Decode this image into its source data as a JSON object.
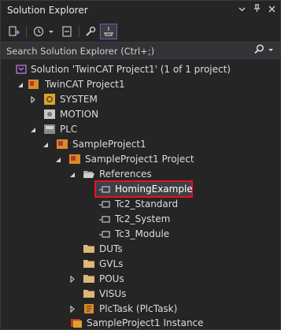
{
  "panel": {
    "title": "Solution Explorer",
    "title_icons": [
      "chevron-down-icon",
      "pin-icon",
      "close-icon"
    ]
  },
  "toolbar": {
    "buttons": [
      "switch-views-icon",
      "history-icon",
      "history-dropdown-icon",
      "collapse-all-icon",
      "properties-wrench-icon",
      "preview-selected-icon"
    ]
  },
  "search": {
    "placeholder": "Search Solution Explorer (Ctrl+;)"
  },
  "tree": {
    "solution": "Solution 'TwinCAT Project1' (1 of 1 project)",
    "project": "TwinCAT Project1",
    "system": "SYSTEM",
    "motion": "MOTION",
    "plc": "PLC",
    "sample_project": "SampleProject1",
    "sample_project_project": "SampleProject1 Project",
    "references": "References",
    "homing_example": "HomingExample",
    "tc2_standard": "Tc2_Standard",
    "tc2_system": "Tc2_System",
    "tc3_module": "Tc3_Module",
    "duts": "DUTs",
    "gvls": "GVLs",
    "pous": "POUs",
    "visus": "VISUs",
    "plc_task": "PlcTask (PlcTask)",
    "instance": "SampleProject1 Instance"
  },
  "colors": {
    "background": "#252526",
    "highlight_border": "#e81123",
    "folder": "#dcb67a",
    "accent": "#6a5acd"
  }
}
